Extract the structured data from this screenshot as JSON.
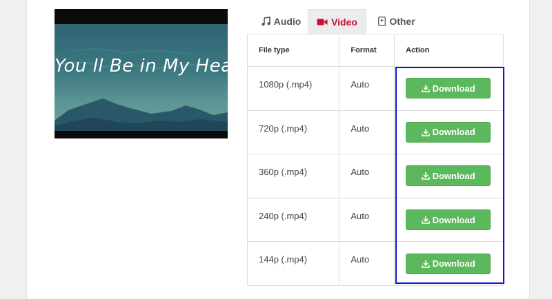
{
  "video": {
    "thumbnail_title": "You ll Be in My Heart"
  },
  "tabs": [
    {
      "label": "Audio",
      "icon": "music-note-icon"
    },
    {
      "label": "Video",
      "icon": "video-camera-icon",
      "active": true
    },
    {
      "label": "Other",
      "icon": "file-icon"
    }
  ],
  "table": {
    "headers": [
      "File type",
      "Format",
      "Action"
    ],
    "rows": [
      {
        "file_type": "1080p (.mp4)",
        "format": "Auto",
        "action": "Download"
      },
      {
        "file_type": "720p (.mp4)",
        "format": "Auto",
        "action": "Download"
      },
      {
        "file_type": "360p (.mp4)",
        "format": "Auto",
        "action": "Download"
      },
      {
        "file_type": "240p (.mp4)",
        "format": "Auto",
        "action": "Download"
      },
      {
        "file_type": "144p (.mp4)",
        "format": "Auto",
        "action": "Download"
      }
    ]
  },
  "colors": {
    "active_tab": "#c8102e",
    "download_button": "#5cb85c",
    "highlight_border": "#1414d0"
  }
}
